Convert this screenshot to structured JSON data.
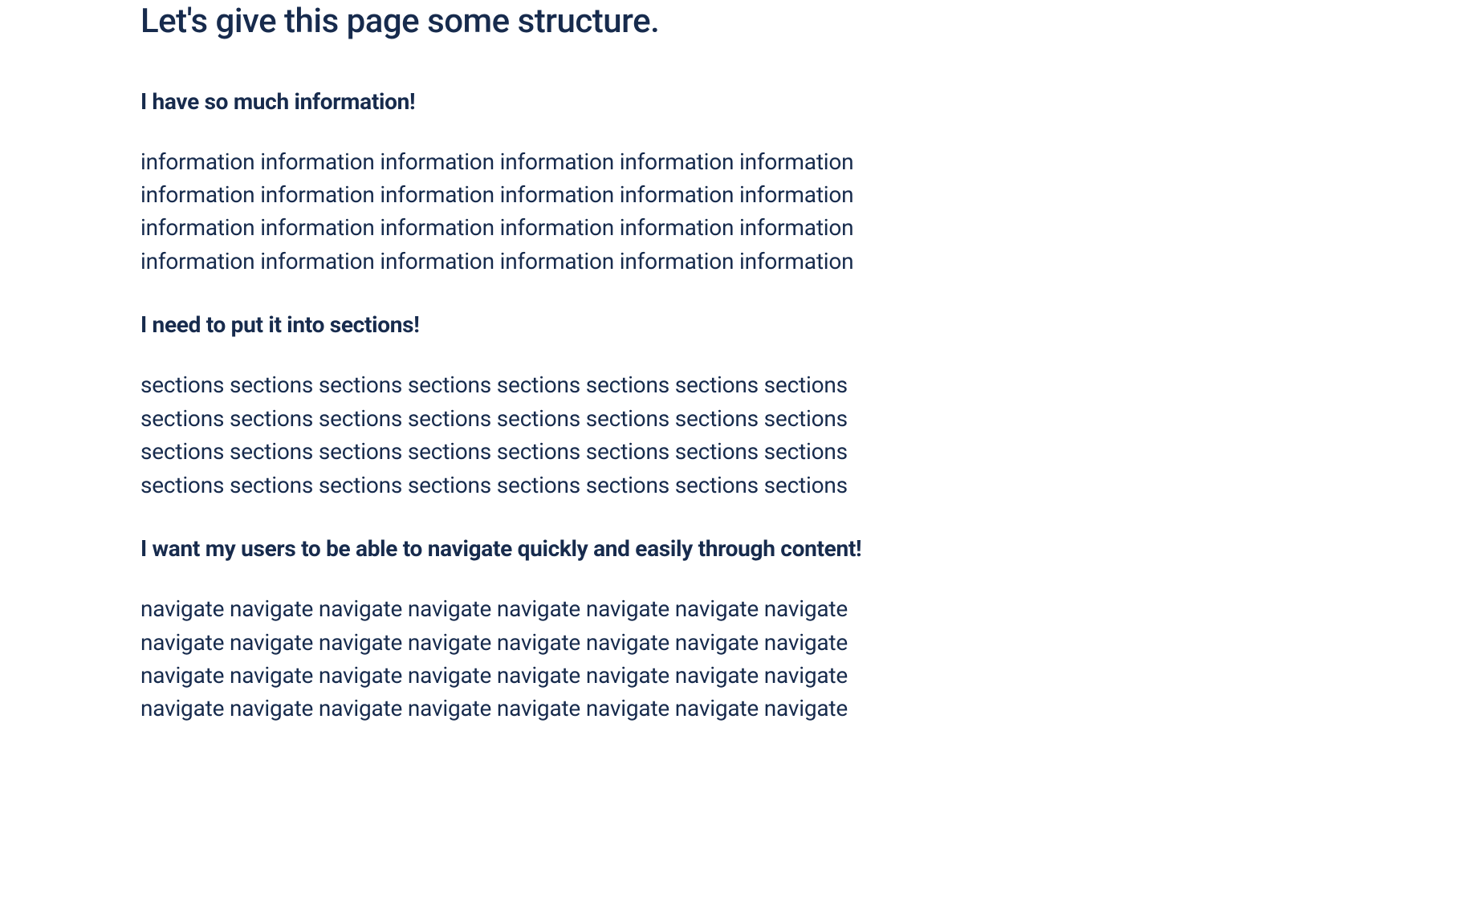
{
  "page": {
    "title": "Let's give this page some structure."
  },
  "sections": {
    "s1": {
      "heading": "I have so much information!",
      "body": "information information information information information information information information information information information information information information information information information information information information information information information information"
    },
    "s2": {
      "heading": "I need to put it into sections!",
      "body": "sections sections sections sections sections sections sections sections sections sections sections sections sections sections sections sections sections sections sections sections sections sections sections sections sections sections sections sections sections sections sections sections"
    },
    "s3": {
      "heading": "I want my users to be able to navigate quickly and easily through content!",
      "body": "navigate navigate navigate navigate navigate navigate navigate navigate navigate navigate navigate navigate navigate navigate navigate navigate navigate navigate navigate navigate navigate navigate navigate navigate navigate navigate navigate navigate navigate navigate navigate navigate"
    }
  }
}
